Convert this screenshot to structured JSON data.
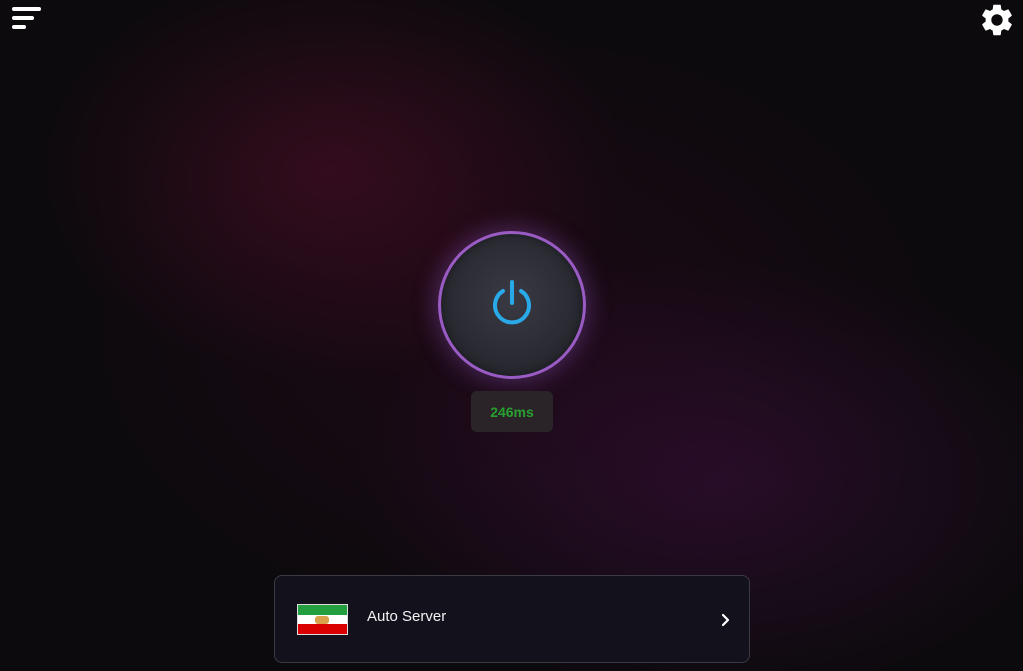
{
  "header": {
    "menu_icon": "menu-lines-icon",
    "settings_icon": "gear-icon"
  },
  "connection": {
    "power_icon": "power-icon",
    "ping": "246ms",
    "power_color": "#29a9e8",
    "ring_color": "#9a5cc4",
    "ping_color": "#28a030"
  },
  "server": {
    "name": "Auto Server",
    "flag_icon": "iran-flag-icon",
    "chevron_icon": "chevron-right-icon"
  }
}
